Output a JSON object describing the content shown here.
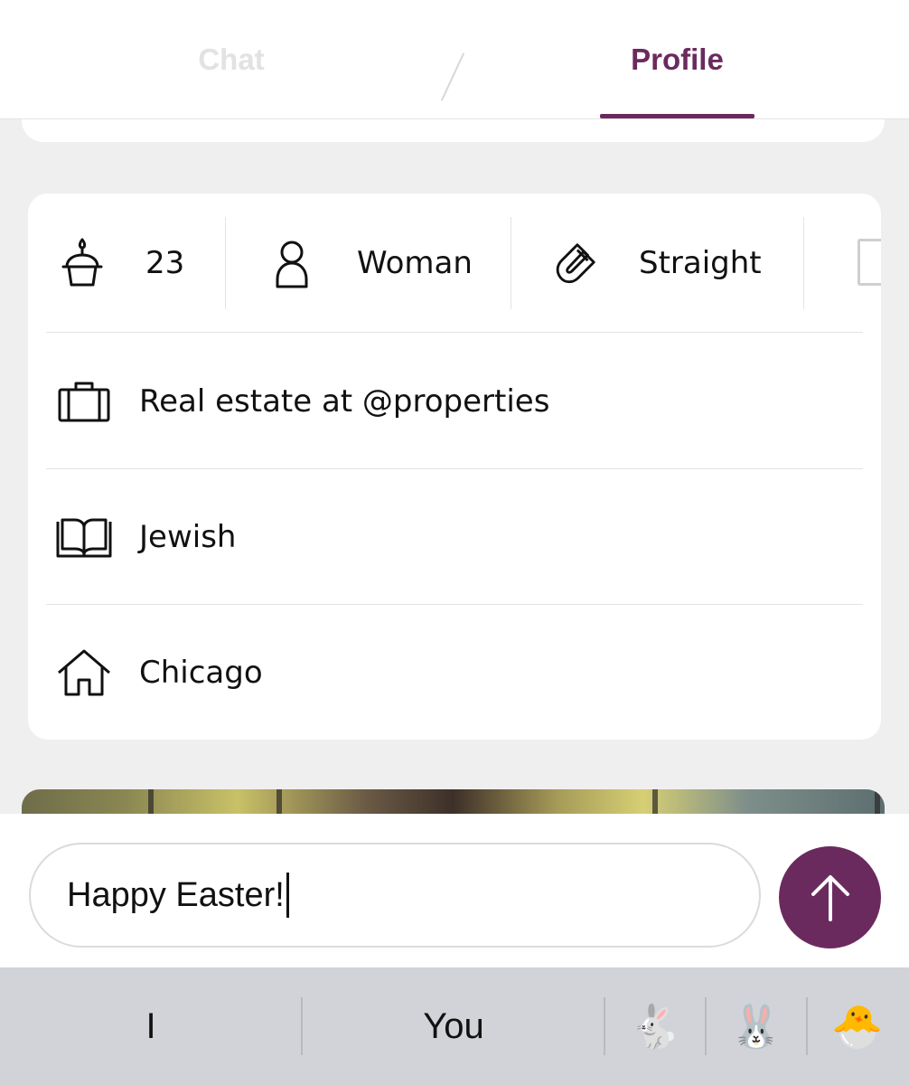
{
  "tabs": {
    "chat_label": "Chat",
    "profile_label": "Profile",
    "active": "Profile"
  },
  "profile": {
    "stats": {
      "age": "23",
      "gender": "Woman",
      "orientation": "Straight"
    },
    "details": {
      "job": "Real estate at @properties",
      "religion": "Jewish",
      "hometown": "Chicago"
    }
  },
  "icons": {
    "age": "birthday-cake-icon",
    "gender": "person-icon",
    "orientation": "magnet-icon",
    "height": "ruler-icon",
    "job": "briefcase-icon",
    "religion": "open-book-icon",
    "hometown": "house-icon",
    "send": "arrow-up-icon"
  },
  "composer": {
    "value": "Happy Easter!"
  },
  "keyboard": {
    "suggestions": [
      "I",
      "You"
    ],
    "emoji": [
      "🐇",
      "🐰",
      "🐣"
    ]
  },
  "colors": {
    "accent": "#6b2a5e",
    "inactive_tab": "#e3e1e1",
    "background": "#f0efef",
    "keyboard": "#d2d3d8"
  }
}
